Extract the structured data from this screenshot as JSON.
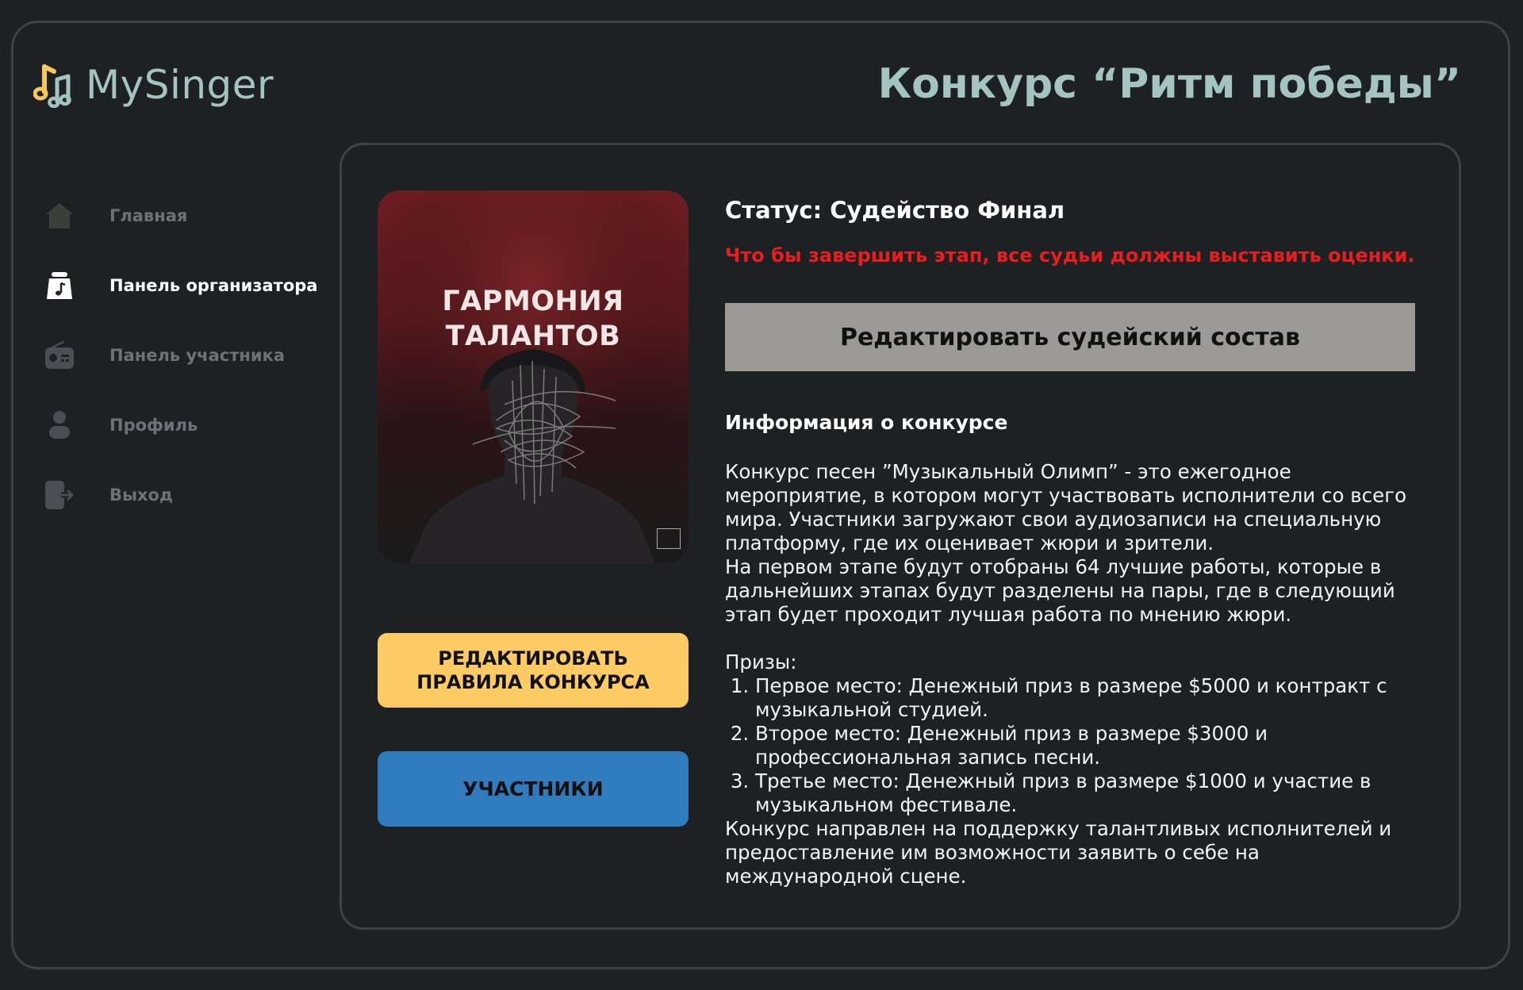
{
  "app": {
    "name": "MySinger",
    "title": "Конкурс “Ритм победы”"
  },
  "sidebar": {
    "items": [
      {
        "label": "Главная",
        "icon": "home-icon",
        "active": false
      },
      {
        "label": "Панель организатора",
        "icon": "organizer-icon",
        "active": true
      },
      {
        "label": "Панель участника",
        "icon": "radio-icon",
        "active": false
      },
      {
        "label": "Профиль",
        "icon": "user-icon",
        "active": false
      },
      {
        "label": "Выход",
        "icon": "logout-icon",
        "active": false
      }
    ]
  },
  "cover": {
    "title_line1": "ГАРМОНИЯ",
    "title_line2": "ТАЛАНТОВ"
  },
  "actions": {
    "edit_rules_label": "РЕДАКТИРОВАТЬ  ПРАВИЛА КОНКУРСА",
    "participants_label": "УЧАСТНИКИ",
    "edit_judges_label": "Редактировать судейский состав"
  },
  "contest": {
    "status": "Статус: Судейство Финал",
    "warning": "Что бы завершить этап, все судьи должны выставить оценки.",
    "info_heading": "Информация о конкурсе",
    "description_1": "Конкурс песен ”Музыкальный Олимп” - это ежегодное мероприятие, в котором могут участвовать исполнители со всего мира. Участники загружают свои аудиозаписи на специальную платформу, где их оценивает жюри и зрители.",
    "description_2": "На первом этапе будут отобраны 64 лучшие работы, которые в дальнейших этапах будут разделены на пары, где в следующий этап будет проходит лучшая работа по мнению жюри.",
    "prizes_heading": "Призы:",
    "prizes": [
      "Первое место: Денежный приз в размере $5000 и контракт с музыкальной студией.",
      "Второе место: Денежный приз в размере $3000 и профессиональная запись песни.",
      "Третье место: Денежный приз в размере $1000 и участие в музыкальном фестивале."
    ],
    "closing": "Конкурс направлен на поддержку талантливых исполнителей и предоставление им возможности заявить о себе на международной сцене."
  },
  "colors": {
    "background": "#1e2124",
    "accent": "#a3c4c0",
    "warning": "#e81d1d",
    "rules_button": "#fccb64",
    "participants_button": "#307bbd",
    "judges_button": "#9b9a94"
  }
}
